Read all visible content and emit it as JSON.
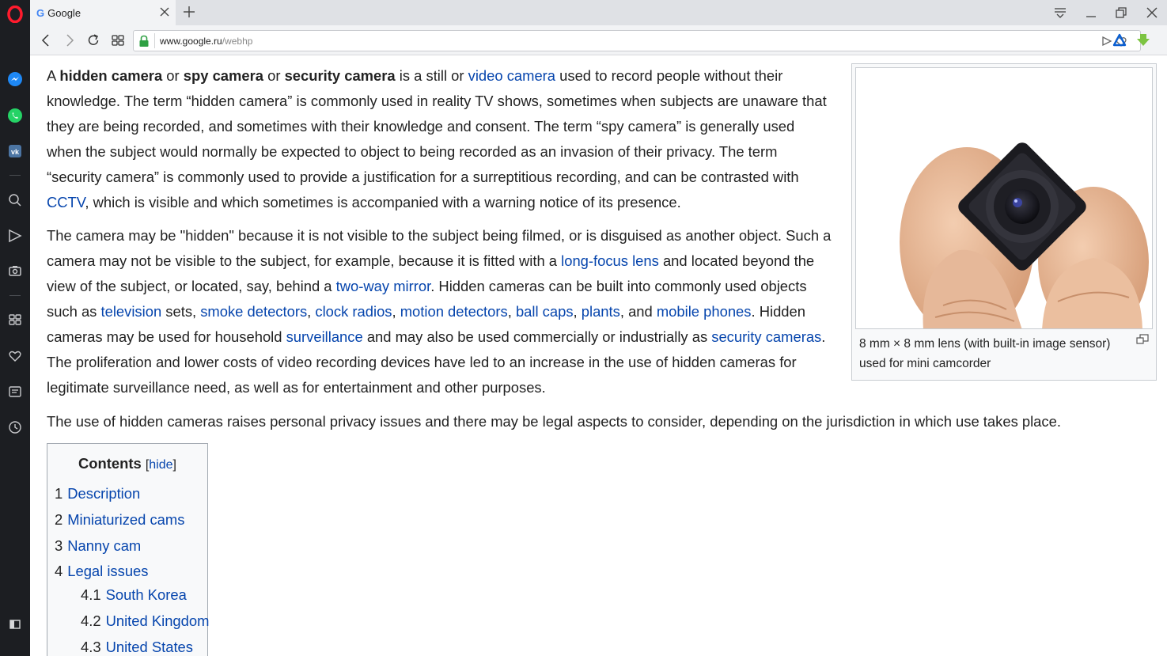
{
  "browser": {
    "tab": {
      "favicon": "G",
      "title": "Google"
    },
    "address": {
      "host": "www.google.ru",
      "path": "/webhp"
    }
  },
  "sidebar": {
    "icons": [
      "opera-logo-icon",
      "messenger-icon",
      "whatsapp-icon",
      "vk-icon",
      "search-icon",
      "send-icon",
      "camera-icon",
      "speed-dial-icon",
      "heart-icon",
      "news-icon",
      "history-icon",
      "sidebar-toggle-icon"
    ]
  },
  "article": {
    "p1": {
      "t1": "A ",
      "b1": "hidden camera",
      "t2": " or ",
      "b2": "spy camera",
      "t3": " or ",
      "b3": "security camera",
      "t4": " is a still or ",
      "l1": "video camera",
      "t5": " used to record people without their knowledge. The term “hidden camera” is commonly used in reality TV shows, sometimes when subjects are unaware that they are being recorded, and sometimes with their knowledge and consent. The term “spy camera” is generally used when the subject would normally be expected to object to being recorded as an invasion of their privacy. The term “security camera” is commonly used to provide a justification for a surreptitious recording, and can be contrasted with ",
      "l2": "CCTV",
      "t6": ", which is visible and which sometimes is accompanied with a warning notice of its presence."
    },
    "p2": {
      "t1": "The camera may be \"hidden\" because it is not visible to the subject being filmed, or is disguised as another object. Such a camera may not be visible to the subject, for example, because it is fitted with a ",
      "l1": "long-focus lens",
      "t2": " and located beyond the view of the subject, or located, say, behind a ",
      "l2": "two-way mirror",
      "t3": ". Hidden cameras can be built into commonly used objects such as ",
      "l3": "television",
      "t4": " sets, ",
      "l4": "smoke detectors",
      "t5": ", ",
      "l5": "clock radios",
      "t6": ", ",
      "l6": "motion detectors",
      "t7": ", ",
      "l7": "ball caps",
      "t8": ", ",
      "l8": "plants",
      "t9": ", and ",
      "l9": "mobile phones",
      "t10": ". Hidden cameras may be used for household ",
      "l10": "surveillance",
      "t11": " and may also be used commercially or industrially as ",
      "l11": "security cameras",
      "t12": ". The proliferation and lower costs of video recording devices have led to an increase in the use of hidden cameras for legitimate surveillance need, as well as for entertainment and other purposes."
    },
    "p3": "The use of hidden cameras raises personal privacy issues and there may be legal aspects to consider, depending on the jurisdiction in which use takes place."
  },
  "figure": {
    "caption": "8 mm × 8 mm lens (with built-in image sensor) used for mini camcorder"
  },
  "toc": {
    "title": "Contents",
    "hide_open": "[",
    "hide": "hide",
    "hide_close": "]",
    "items": [
      {
        "num": "1",
        "label": "Description"
      },
      {
        "num": "2",
        "label": "Miniaturized cams"
      },
      {
        "num": "3",
        "label": "Nanny cam"
      },
      {
        "num": "4",
        "label": "Legal issues"
      },
      {
        "num": "4.1",
        "label": "South Korea"
      },
      {
        "num": "4.2",
        "label": "United Kingdom"
      },
      {
        "num": "4.3",
        "label": "United States"
      }
    ]
  },
  "colors": {
    "link": "#0645ad",
    "sidebar": "#1c1e22",
    "opera": "#ff1b2d"
  }
}
